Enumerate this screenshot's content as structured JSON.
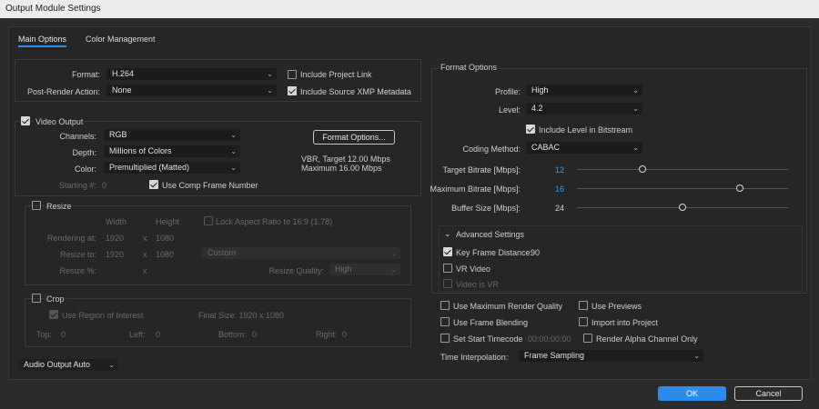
{
  "window": {
    "title": "Output Module Settings"
  },
  "tabs": [
    {
      "label": "Main Options"
    },
    {
      "label": "Color Management"
    }
  ],
  "left": {
    "format_label": "Format:",
    "format_value": "H.264",
    "post_render_label": "Post-Render Action:",
    "post_render_value": "None",
    "include_project_link": {
      "label": "Include Project Link",
      "checked": false
    },
    "include_xmp": {
      "label": "Include Source XMP Metadata",
      "checked": true
    },
    "video_output": {
      "label": "Video Output",
      "checked": true,
      "channels_label": "Channels:",
      "channels_value": "RGB",
      "depth_label": "Depth:",
      "depth_value": "Millions of Colors",
      "color_label": "Color:",
      "color_value": "Premultiplied (Matted)",
      "starting_label": "Starting #:",
      "starting_value": "0",
      "comp_frame_label": "Use Comp Frame Number",
      "format_options_button": "Format Options...",
      "summary_line1": "VBR, Target 12.00 Mbps",
      "summary_line2": "Maximum 16.00 Mbps"
    },
    "resize": {
      "label": "Resize",
      "width_header": "Width",
      "height_header": "Height",
      "lock_label": "Lock Aspect Ratio to 16:9 (1.78)",
      "rendering_at_label": "Rendering at:",
      "rendering_w": "1920",
      "rendering_h": "1080",
      "resize_to_label": "Resize to:",
      "resize_w": "1920",
      "resize_h": "1080",
      "custom_value": "Custom",
      "resize_pct_label": "Resize %:",
      "x": "x",
      "quality_label": "Resize Quality:",
      "quality_value": "High"
    },
    "crop": {
      "label": "Crop",
      "roi_label": "Use Region of Interest",
      "final_size": "Final Size: 1920 x 1080",
      "top_label": "Top:",
      "top_value": "0",
      "left_label": "Left:",
      "left_value": "0",
      "bottom_label": "Bottom:",
      "bottom_value": "0",
      "right_label": "Right:",
      "right_value": "0"
    },
    "audio_output": "Audio Output Auto"
  },
  "right": {
    "format_options_title": "Format Options",
    "profile_label": "Profile:",
    "profile_value": "High",
    "level_label": "Level:",
    "level_value": "4.2",
    "include_level_label": "Include Level in Bitstream",
    "coding_label": "Coding Method:",
    "coding_value": "CABAC",
    "target_bitrate_label": "Target Bitrate [Mbps]:",
    "target_bitrate_value": "12",
    "max_bitrate_label": "Maximum Bitrate [Mbps]:",
    "max_bitrate_value": "16",
    "buffer_size_label": "Buffer Size [Mbps]:",
    "buffer_size_value": "24",
    "sliders": {
      "target_fraction": 0.31,
      "max_fraction": 0.77,
      "buffer_fraction": 0.5
    },
    "advanced": {
      "title": "Advanced Settings",
      "key_frame_label": "Key Frame Distance:",
      "key_frame_value": "90",
      "vr_video_label": "VR Video",
      "video_is_vr_label": "Video is VR"
    },
    "options": {
      "max_render_quality": "Use Maximum Render Quality",
      "use_previews": "Use Previews",
      "frame_blending": "Use Frame Blending",
      "import_project": "Import into Project",
      "start_timecode": "Set Start Timecode",
      "timecode_value": "00:00:00:00",
      "render_alpha": "Render Alpha Channel Only"
    },
    "time_interp_label": "Time Interpolation:",
    "time_interp_value": "Frame Sampling"
  },
  "footer": {
    "ok": "OK",
    "cancel": "Cancel"
  },
  "colors": {
    "accent": "#2d8ceb",
    "value_blue": "#3d9be9",
    "background": "#2b2b2b"
  }
}
